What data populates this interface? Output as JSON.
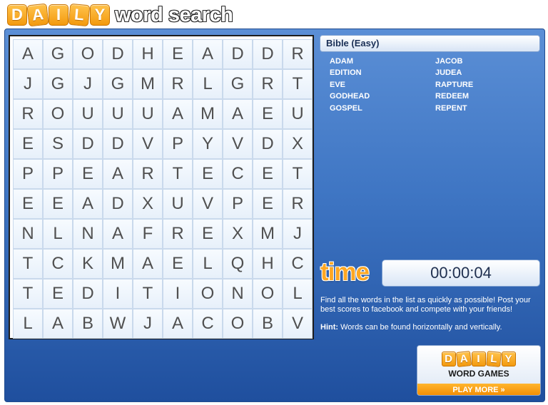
{
  "header": {
    "logo_tiles": [
      "D",
      "A",
      "I",
      "L",
      "Y"
    ],
    "logo_word": "word search"
  },
  "grid": [
    [
      "A",
      "G",
      "O",
      "D",
      "H",
      "E",
      "A",
      "D",
      "D",
      "R"
    ],
    [
      "J",
      "G",
      "J",
      "G",
      "M",
      "R",
      "L",
      "G",
      "R",
      "T"
    ],
    [
      "R",
      "O",
      "U",
      "U",
      "U",
      "A",
      "M",
      "A",
      "E",
      "U"
    ],
    [
      "E",
      "S",
      "D",
      "D",
      "V",
      "P",
      "Y",
      "V",
      "D",
      "X"
    ],
    [
      "P",
      "P",
      "E",
      "A",
      "R",
      "T",
      "E",
      "C",
      "E",
      "T"
    ],
    [
      "E",
      "E",
      "A",
      "D",
      "X",
      "U",
      "V",
      "P",
      "E",
      "R"
    ],
    [
      "N",
      "L",
      "N",
      "A",
      "F",
      "R",
      "E",
      "X",
      "M",
      "J"
    ],
    [
      "T",
      "C",
      "K",
      "M",
      "A",
      "E",
      "L",
      "Q",
      "H",
      "C"
    ],
    [
      "T",
      "E",
      "D",
      "I",
      "T",
      "I",
      "O",
      "N",
      "O",
      "L"
    ],
    [
      "L",
      "A",
      "B",
      "W",
      "J",
      "A",
      "C",
      "O",
      "B",
      "V"
    ]
  ],
  "category": "Bible (Easy)",
  "words": [
    "ADAM",
    "JACOB",
    "EDITION",
    "JUDEA",
    "EVE",
    "RAPTURE",
    "GODHEAD",
    "REDEEM",
    "GOSPEL",
    "REPENT"
  ],
  "timer": {
    "label": "time",
    "value": "00:00:04"
  },
  "instructions": "Find all the words in the list as quickly as possible! Post your best scores to facebook and compete with your friends!",
  "hint": {
    "label": "Hint:",
    "text": " Words can be found horizontally and vertically."
  },
  "promo": {
    "tiles": [
      "D",
      "A",
      "I",
      "L",
      "Y"
    ],
    "title": "WORD GAMES",
    "button": "PLAY MORE »"
  },
  "colors": {
    "accent": "#ffa722",
    "panel": "#3e75c3"
  }
}
